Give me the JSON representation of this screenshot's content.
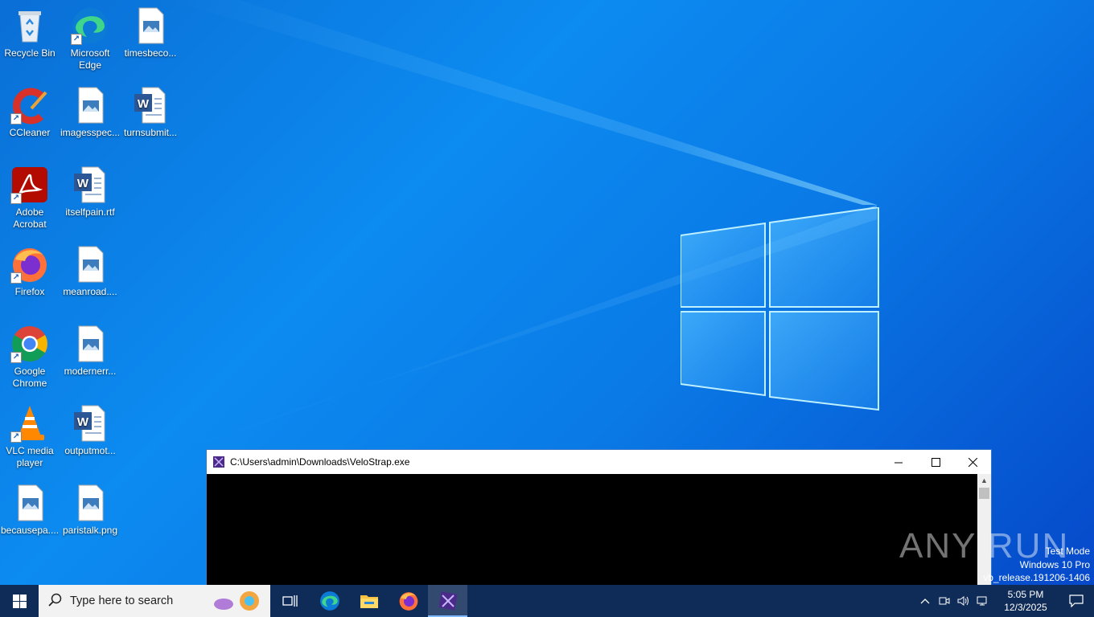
{
  "desktop": {
    "icons": [
      {
        "label": "Recycle Bin",
        "icon": "recycle-bin-icon"
      },
      {
        "label": "Microsoft Edge",
        "icon": "edge-icon"
      },
      {
        "label": "timesbeco...",
        "icon": "image-file-icon"
      },
      {
        "label": "CCleaner",
        "icon": "ccleaner-icon"
      },
      {
        "label": "imagesspec...",
        "icon": "image-file-icon"
      },
      {
        "label": "turnsubmit...",
        "icon": "word-doc-icon"
      },
      {
        "label": "Adobe Acrobat",
        "icon": "acrobat-icon"
      },
      {
        "label": "itselfpain.rtf",
        "icon": "word-doc-icon"
      },
      {
        "label": "Firefox",
        "icon": "firefox-icon"
      },
      {
        "label": "meanroad....",
        "icon": "image-file-icon"
      },
      {
        "label": "Google Chrome",
        "icon": "chrome-icon"
      },
      {
        "label": "modernerr...",
        "icon": "image-file-icon"
      },
      {
        "label": "VLC media player",
        "icon": "vlc-icon"
      },
      {
        "label": "outputmot...",
        "icon": "word-doc-icon"
      },
      {
        "label": "becausepa....",
        "icon": "image-file-icon"
      },
      {
        "label": "paristalk.png",
        "icon": "image-file-icon"
      }
    ]
  },
  "console": {
    "title": "C:\\Users\\admin\\Downloads\\VeloStrap.exe"
  },
  "watermark": {
    "brand": "ANY RUN",
    "line1": "Test Mode",
    "line2": "Windows 10 Pro",
    "line3": "vb_release.191206-1406"
  },
  "taskbar": {
    "search_placeholder": "Type here to search",
    "time": "5:05 PM",
    "date": "12/3/2025"
  },
  "colors": {
    "taskbar_bg": "#0f2b57",
    "desktop_accent": "#0a7ae6"
  }
}
